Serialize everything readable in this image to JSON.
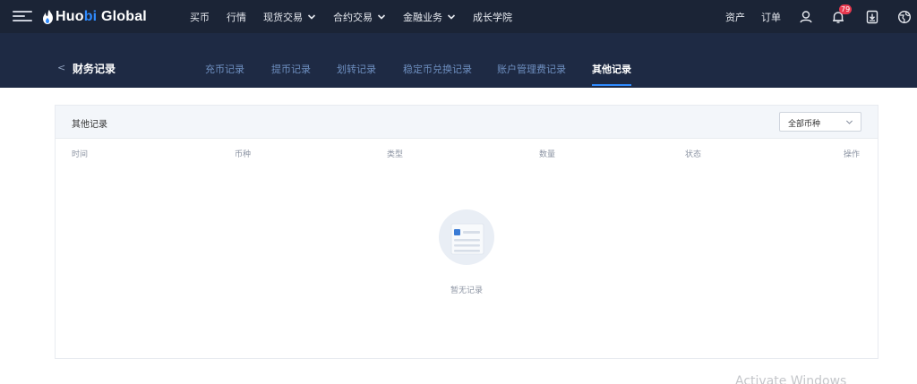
{
  "topbar": {
    "logo": {
      "part1": "Huo",
      "part2": "bi",
      "part3": " Global"
    },
    "nav": [
      {
        "label": "买币",
        "dropdown": false
      },
      {
        "label": "行情",
        "dropdown": false
      },
      {
        "label": "现货交易",
        "dropdown": true
      },
      {
        "label": "合约交易",
        "dropdown": true
      },
      {
        "label": "金融业务",
        "dropdown": true
      },
      {
        "label": "成长学院",
        "dropdown": false
      }
    ],
    "right": {
      "assets": "资产",
      "orders": "订单",
      "notification_count": "79"
    },
    "icons": [
      "menu-icon",
      "user-icon",
      "bell-icon",
      "download-icon",
      "globe-icon"
    ]
  },
  "subheader": {
    "back": "<",
    "title": "财务记录",
    "tabs": [
      {
        "label": "充币记录",
        "active": false
      },
      {
        "label": "提币记录",
        "active": false
      },
      {
        "label": "划转记录",
        "active": false
      },
      {
        "label": "稳定币兑换记录",
        "active": false
      },
      {
        "label": "账户管理费记录",
        "active": false
      },
      {
        "label": "其他记录",
        "active": true
      }
    ]
  },
  "panel": {
    "title": "其他记录",
    "currency_select": "全部币种",
    "columns": [
      "时间",
      "币种",
      "类型",
      "数量",
      "状态",
      "操作"
    ],
    "empty_text": "暂无记录"
  },
  "watermark": "Activate Windows",
  "colors": {
    "topbar_bg": "#1b2436",
    "subbar_bg": "#1e2a44",
    "accent": "#2f8bff",
    "badge": "#e8384f"
  }
}
